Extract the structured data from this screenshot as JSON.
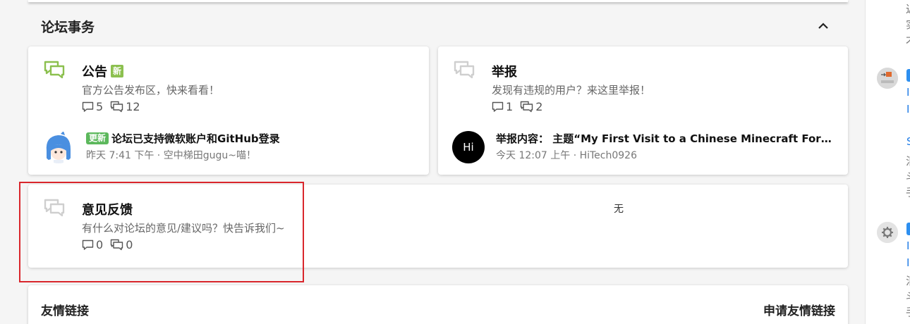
{
  "section": {
    "title": "论坛事务",
    "collapse_icon": "chevron-up-icon"
  },
  "categories": [
    {
      "title": "公告",
      "badge": "新",
      "description": "官方公告发布区，快来看看！",
      "discussions": "5",
      "posts": "12",
      "icon_color": "#8cc04f",
      "last_post": {
        "tag": "更新",
        "title": "论坛已支持微软账户和GitHub登录",
        "meta": "昨天 7:41 下午 · 空中梯田gugu~喵！",
        "avatar": "anime-girl-avatar"
      }
    },
    {
      "title": "举报",
      "description": "发现有违规的用户？来这里举报！",
      "discussions": "1",
      "posts": "2",
      "icon_color": "#cfcfcf",
      "last_post": {
        "title": "举报内容： 主题“My First Visit to a Chinese Minecraft Forum”的帖子",
        "meta": "今天 12:07 上午 · HiTech0926",
        "avatar_text": "Hi"
      }
    },
    {
      "title": "意见反馈",
      "description": "有什么对论坛的意见/建议吗？快告诉我们~",
      "discussions": "0",
      "posts": "0",
      "icon_color": "#cfcfcf",
      "empty_label": "无"
    }
  ],
  "friend_links": {
    "title": "友情链接",
    "apply": "申请友情链接"
  },
  "sidebar_right": {
    "chars": [
      "近",
      "实",
      "才",
      "I",
      "I",
      "S",
      "泪",
      "斗",
      "手",
      "I",
      "I",
      "泪",
      "斗",
      "手"
    ]
  }
}
